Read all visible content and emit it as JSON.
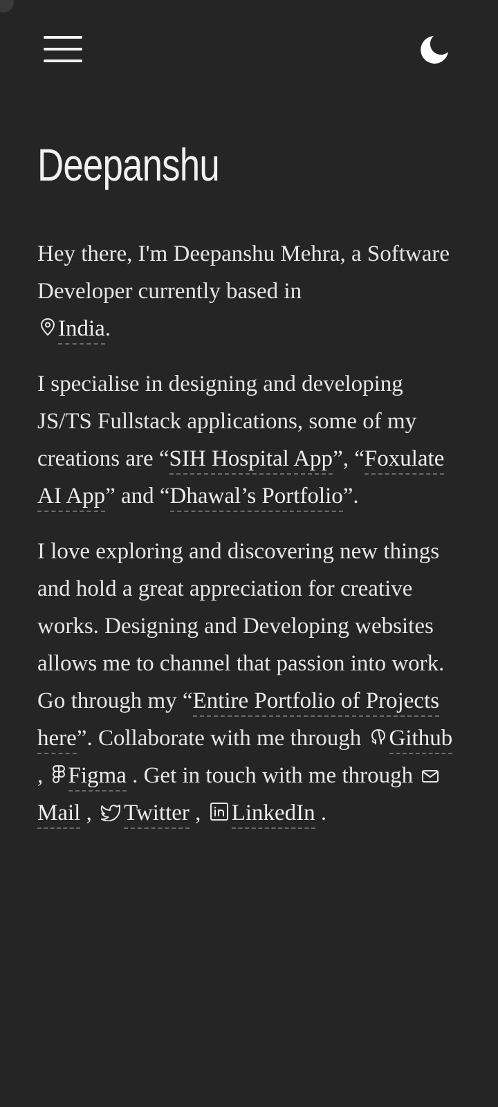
{
  "header": {
    "menu_icon": "hamburger-menu-icon",
    "theme_icon": "moon-icon"
  },
  "page": {
    "title": "Deepanshu"
  },
  "intro": {
    "prefix": "Hey there, I'm Deepanshu Mehra, a Software Developer currently based in",
    "location_icon": "map-pin-icon",
    "location": "India",
    "suffix": "."
  },
  "specialise": {
    "text1": "I specialise in designing and developing JS/TS Fullstack applications, some of my creations are “",
    "project1": "SIH Hospital App",
    "text2": "”, “",
    "project2": "Foxulate AI App",
    "text3": "” and “",
    "project3": "Dhawal’s Portfolio",
    "text4": "”."
  },
  "about": {
    "text1": "I love exploring and discovering new things and hold a great appreciation for creative works. Designing and Developing websites allows me to channel that passion into work. Go through my “",
    "portfolio_link": "Entire Portfolio of Projects here",
    "text2": "”. Collaborate with me through",
    "github_icon": "github-icon",
    "github": "Github",
    "sep1": ",",
    "figma_icon": "figma-icon",
    "figma": "Figma",
    "text3": ". Get in touch with me through",
    "mail_icon": "mail-icon",
    "mail": "Mail",
    "sep2": ",",
    "twitter_icon": "twitter-icon",
    "twitter": "Twitter",
    "sep3": ",",
    "linkedin_icon": "linkedin-icon",
    "linkedin": "LinkedIn",
    "end": "."
  }
}
